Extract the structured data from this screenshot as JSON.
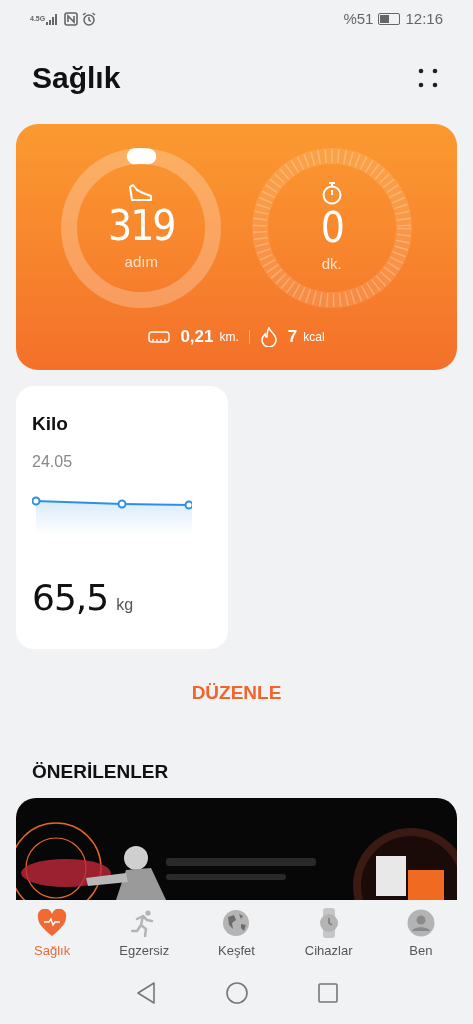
{
  "status_bar": {
    "network": "4.5G",
    "battery_text": "%51",
    "time": "12:16"
  },
  "header": {
    "title": "Sağlık"
  },
  "activity_card": {
    "steps": {
      "value": "319",
      "unit": "adım",
      "level": 0.03
    },
    "minutes": {
      "value": "0",
      "unit": "dk."
    },
    "distance": {
      "value": "0,21",
      "unit": "km."
    },
    "calories": {
      "value": "7",
      "unit": "kcal"
    }
  },
  "weight_card": {
    "title": "Kilo",
    "date": "24.05",
    "value": "65,5",
    "unit": "kg"
  },
  "edit_button": "DÜZENLE",
  "recommended": {
    "title": "ÖNERİLENLER"
  },
  "bottom_nav": [
    {
      "label": "Sağlık",
      "selected": true
    },
    {
      "label": "Egzersiz",
      "selected": false
    },
    {
      "label": "Keşfet",
      "selected": false
    },
    {
      "label": "Cihazlar",
      "selected": false
    },
    {
      "label": "Ben",
      "selected": false
    }
  ]
}
